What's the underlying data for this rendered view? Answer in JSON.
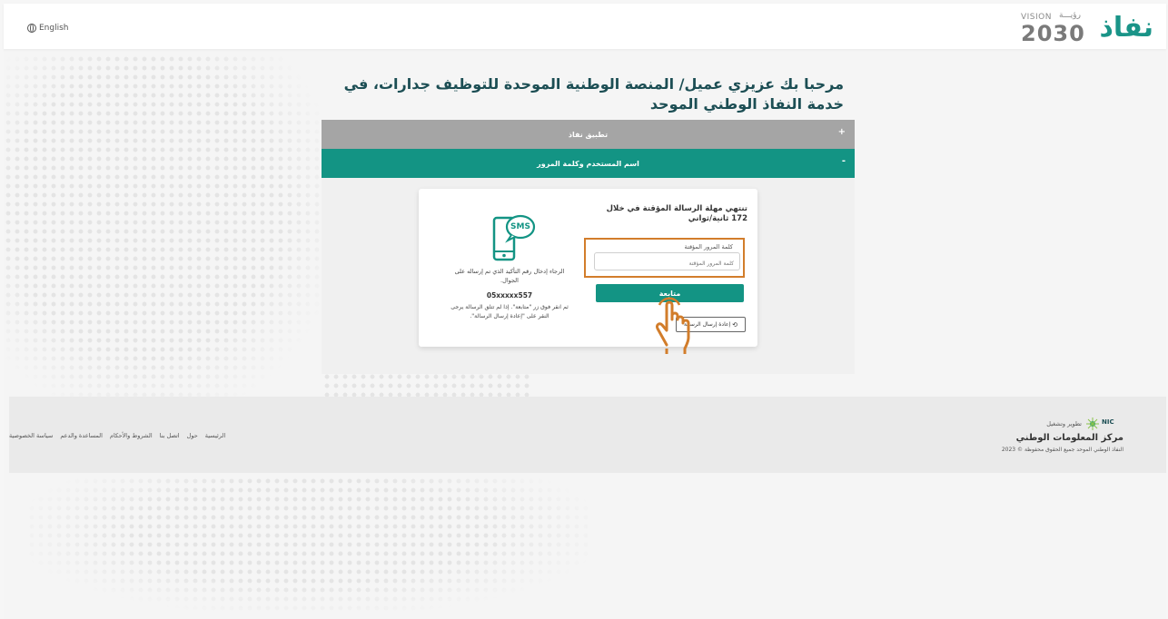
{
  "header": {
    "language_label": "English",
    "logo_text": "نفاذ",
    "vision_small": "VISION",
    "vision_arabic": "رؤيـــة",
    "vision_year": "2030"
  },
  "page_title": "مرحبا بك عزيزي عميل/ المنصة الوطنية الموحدة للتوظيف جدارات، في خدمة النفاذ الوطني الموحد",
  "accordion": [
    {
      "label": "تطبيق نفاذ",
      "sign": "+"
    },
    {
      "label": "اسم المستخدم وكلمة المرور",
      "sign": "-"
    }
  ],
  "otp_card": {
    "timer_text": "تنتهي مهلة الرسالة المؤقتة في خلال 172 ثانية/ثواني",
    "field_label": "كلمة المرور المؤقتة",
    "field_placeholder": "كلمة المرور المؤقتة",
    "follow_button": "متابعة",
    "resend_button": "إعادة إرسال الرسالة",
    "sms_label": "SMS",
    "instruction": "الرجاء إدخال رقم التأكيد الذي تم إرساله على الجوال.",
    "phone_number": "05xxxxx557",
    "instruction2": "ثم انقر فوق زر \"متابعة\". إذا لم تتلق الرسالة يرجى النقر على \"إعادة إرسال الرسالة\"."
  },
  "footer": {
    "links": [
      "الرئيسية",
      "حول",
      "اتصل بنا",
      "الشروط والأحكام",
      "المساعدة والدعم",
      "سياسة الخصوصية"
    ],
    "dev_label": "تطوير وتشغيل",
    "nic_logo": "NIC",
    "org_name": "مركز المعلومات الوطني",
    "copyright": "النفاذ الوطني الموحد جميع الحقوق محفوظة © 2023"
  },
  "colors": {
    "brand": "#139484",
    "title": "#1c4e54",
    "highlight": "#d27d2b",
    "accordion_inactive": "#a5a5a5"
  }
}
